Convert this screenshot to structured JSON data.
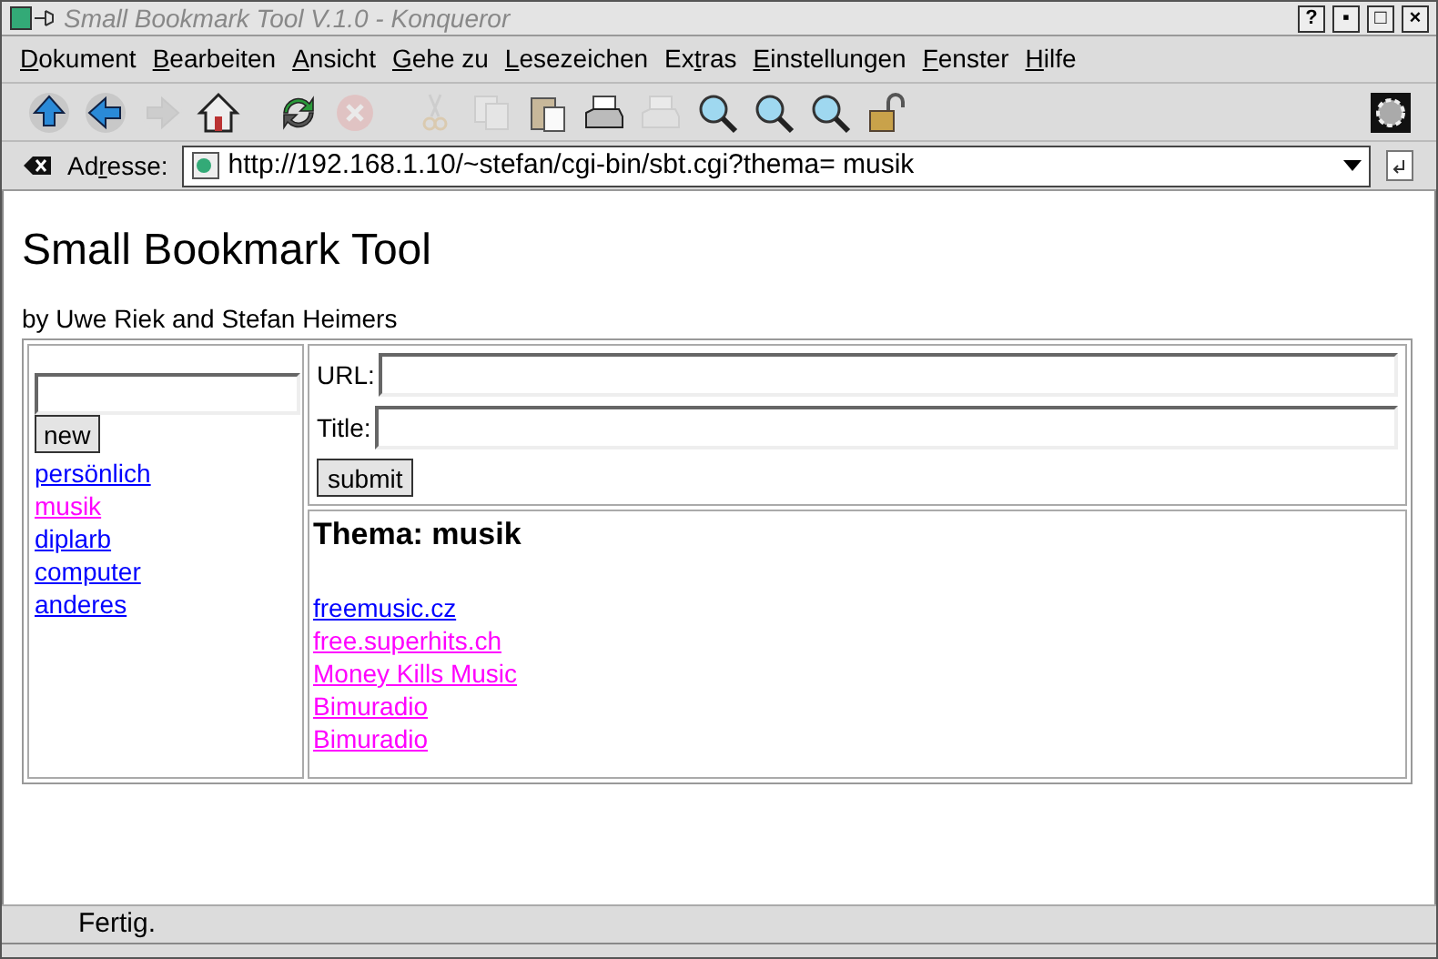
{
  "window": {
    "title": "Small Bookmark Tool V.1.0 - Konqueror",
    "buttons": [
      "?",
      "▪",
      "□",
      "×"
    ]
  },
  "menu": [
    {
      "key": "D",
      "post": "okument"
    },
    {
      "key": "B",
      "post": "earbeiten"
    },
    {
      "key": "A",
      "post": "nsicht"
    },
    {
      "key": "G",
      "post": "ehe zu"
    },
    {
      "key": "L",
      "post": "esezeichen"
    },
    {
      "pre": "Ex",
      "key": "t",
      "post": "ras"
    },
    {
      "key": "E",
      "post": "instellungen"
    },
    {
      "key": "F",
      "post": "enster"
    },
    {
      "key": "H",
      "post": "ilfe"
    }
  ],
  "toolbar": [
    {
      "kind": "up",
      "disabled": false
    },
    {
      "kind": "back",
      "disabled": false
    },
    {
      "kind": "forward",
      "disabled": true
    },
    {
      "kind": "home",
      "disabled": false
    },
    {
      "kind": "sep"
    },
    {
      "kind": "reload",
      "disabled": false
    },
    {
      "kind": "stop",
      "disabled": true
    },
    {
      "kind": "sep"
    },
    {
      "kind": "cut",
      "disabled": true
    },
    {
      "kind": "copy",
      "disabled": true
    },
    {
      "kind": "paste",
      "disabled": false
    },
    {
      "kind": "print",
      "disabled": false
    },
    {
      "kind": "print",
      "disabled": true
    },
    {
      "kind": "zoom",
      "disabled": false
    },
    {
      "kind": "zoom",
      "disabled": false
    },
    {
      "kind": "zoom",
      "disabled": false
    },
    {
      "kind": "lock",
      "disabled": false
    }
  ],
  "address": {
    "label_pre": "Ad",
    "label_key": "r",
    "label_post": "esse:",
    "value": "http://192.168.1.10/~stefan/cgi-bin/sbt.cgi?thema= musik"
  },
  "page": {
    "title": "Small Bookmark Tool",
    "byline": "by Uwe Riek and Stefan Heimers",
    "new_button": "new",
    "topics": [
      {
        "label": "persönlich",
        "visited": false
      },
      {
        "label": "musik",
        "visited": true
      },
      {
        "label": "diplarb",
        "visited": false
      },
      {
        "label": "computer",
        "visited": false
      },
      {
        "label": "anderes",
        "visited": false
      }
    ],
    "form": {
      "url_label": "URL:",
      "title_label": "Title:",
      "submit": "submit"
    },
    "heading": "Thema: musik",
    "bookmarks": [
      {
        "label": "freemusic.cz",
        "visited": false
      },
      {
        "label": "free.superhits.ch",
        "visited": true
      },
      {
        "label": "Money Kills Music",
        "visited": true
      },
      {
        "label": "Bimuradio",
        "visited": true
      },
      {
        "label": "Bimuradio",
        "visited": true
      }
    ]
  },
  "status_bar": "Fertig."
}
